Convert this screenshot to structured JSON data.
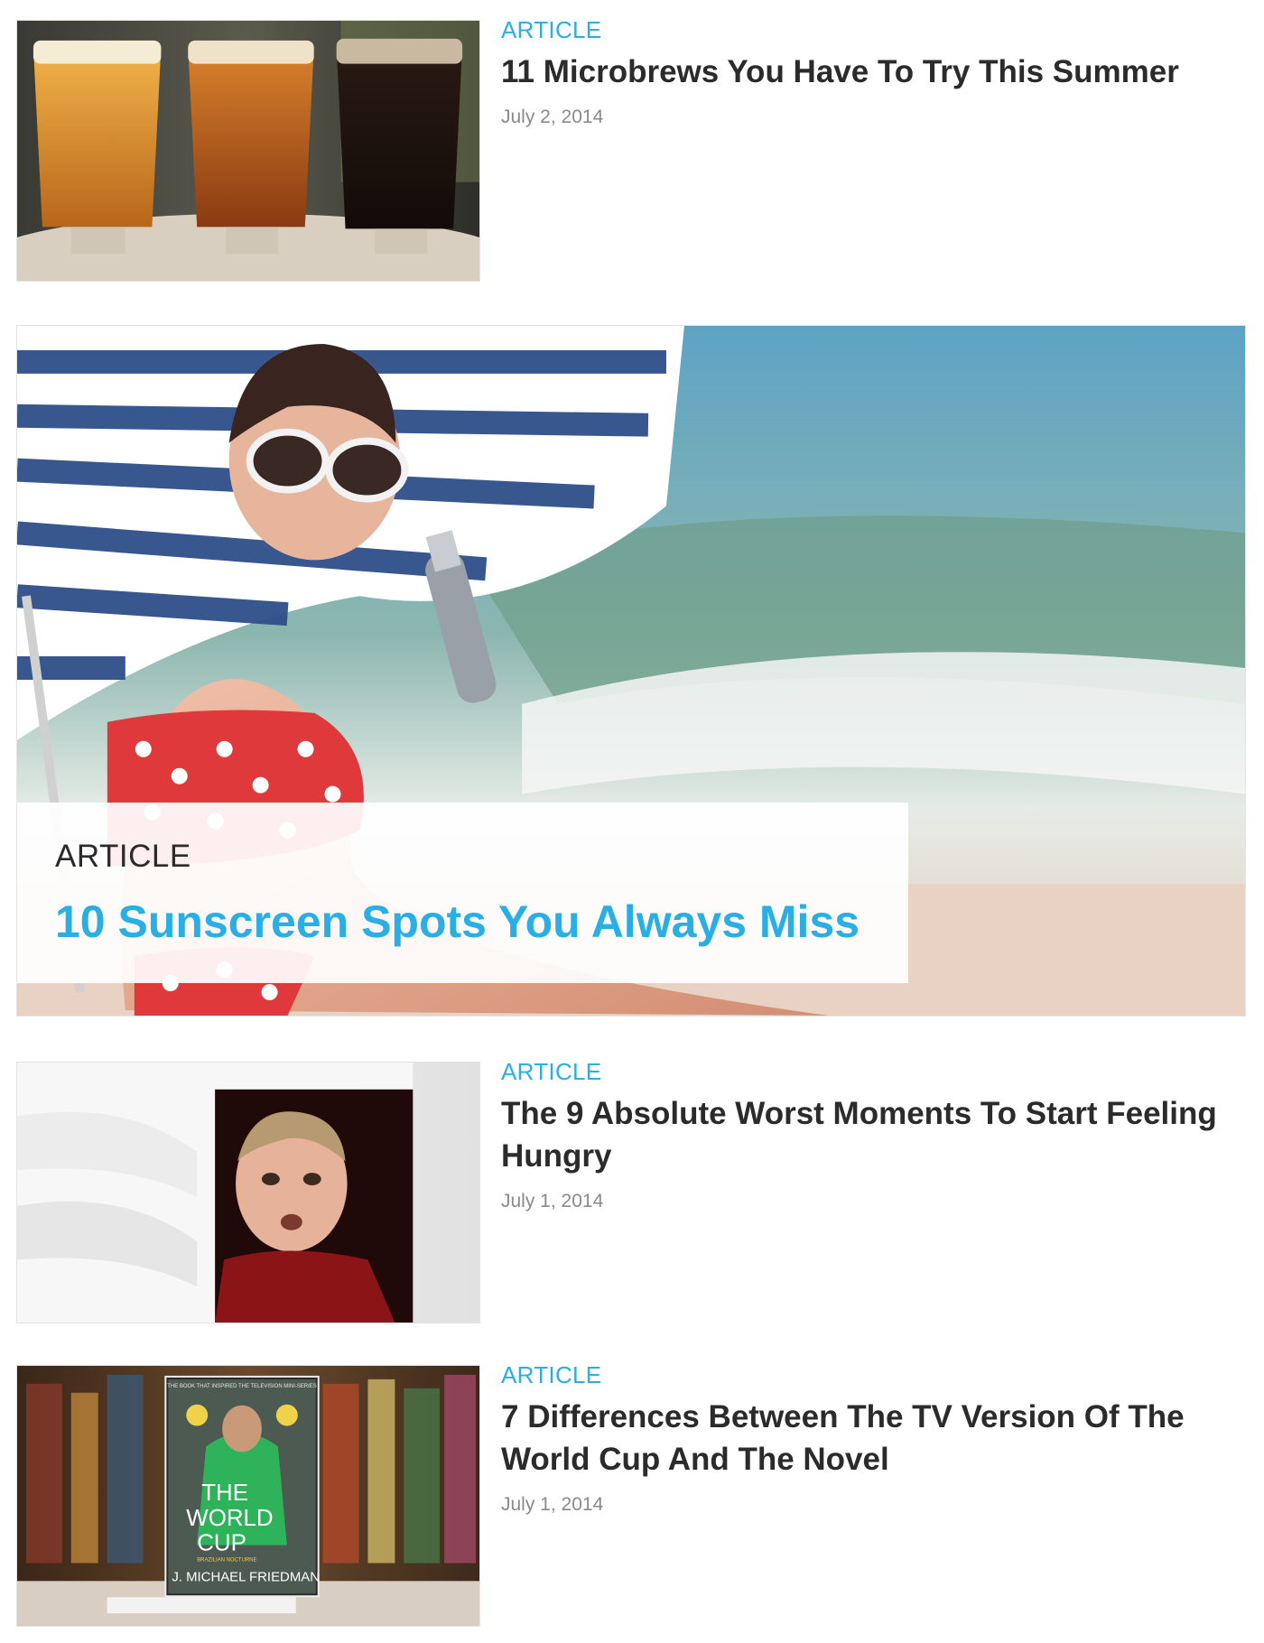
{
  "articles": [
    {
      "category": "ARTICLE",
      "title": "11 Microbrews You Have To Try This Summer",
      "date": "July 2, 2014"
    },
    {
      "category": "ARTICLE",
      "title": "The 9 Absolute Worst Moments To Start Feeling Hungry",
      "date": "July 1, 2014"
    },
    {
      "category": "ARTICLE",
      "title": "7 Differences Between The TV Version Of The World Cup And The Novel",
      "date": "July 1, 2014"
    }
  ],
  "featured": {
    "category": "ARTICLE",
    "title": "10 Sunscreen Spots You Always Miss"
  },
  "book_cover": {
    "tagline": "THE BOOK THAT INSPIRED THE TELEVISION MINI-SERIES",
    "title_line1": "THE",
    "title_line2": "WORLD",
    "title_line3": "CUP",
    "subtitle": "BRAZILIAN NOCTURNE",
    "author": "J. MICHAEL FRIEDMAN"
  },
  "colors": {
    "accent": "#2aaee6",
    "headline": "#2b2b2b",
    "date": "#8a8a8a"
  }
}
